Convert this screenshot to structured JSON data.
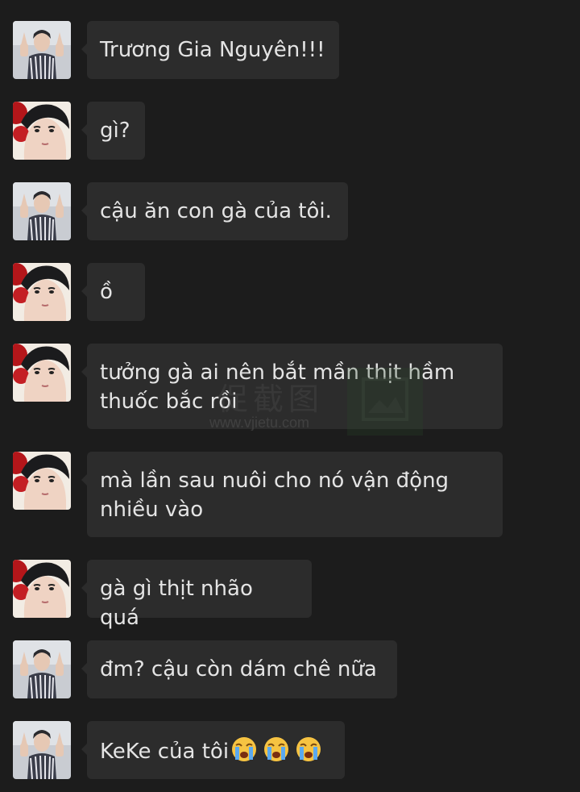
{
  "contacts": {
    "user_a": {
      "avatar_icon": "avatar-striped-shirt-peace-sign"
    },
    "user_b": {
      "avatar_icon": "avatar-closeup-face-red-background"
    }
  },
  "messages": [
    {
      "sender": "user_a",
      "text": "Trương Gia Nguyên!!!"
    },
    {
      "sender": "user_b",
      "text": "gì?"
    },
    {
      "sender": "user_a",
      "text": "cậu ăn con gà của tôi."
    },
    {
      "sender": "user_b",
      "text": "ồ"
    },
    {
      "sender": "user_b",
      "text": "tưởng gà ai nên bắt mần thịt hầm\nthuốc bắc rồi"
    },
    {
      "sender": "user_b",
      "text": "mà lần sau nuôi cho nó vận động\nnhiều vào"
    },
    {
      "sender": "user_b",
      "text": "gà gì thịt nhão quá"
    },
    {
      "sender": "user_a",
      "text": "đm? cậu còn dám chê nữa"
    },
    {
      "sender": "user_a",
      "text": "KeKe của tôi",
      "emojis": [
        "loudly-crying-face-icon",
        "loudly-crying-face-icon",
        "loudly-crying-face-icon"
      ]
    }
  ],
  "watermark": {
    "cn": "促截图",
    "url": "www.vjietu.com"
  },
  "colors": {
    "background": "#1c1c1c",
    "bubble": "#2c2c2c",
    "text": "#e4e4e4"
  }
}
